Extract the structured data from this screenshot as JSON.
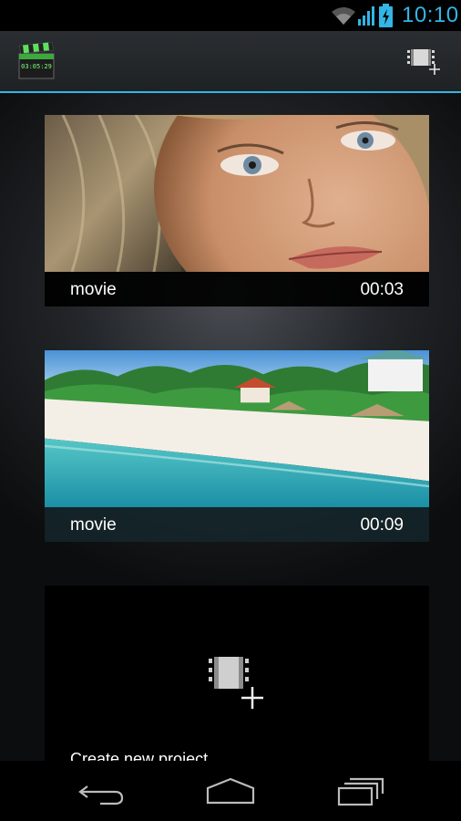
{
  "status_bar": {
    "time": "10:10",
    "icons": [
      "wifi-icon",
      "signal-icon",
      "battery-charging-icon"
    ],
    "accent": "#33b5e5"
  },
  "action_bar": {
    "app_icon": "clapperboard-icon",
    "app_icon_text": "03:05:29",
    "action": "add-video-icon"
  },
  "projects": [
    {
      "name": "movie",
      "duration": "00:03"
    },
    {
      "name": "movie",
      "duration": "00:09"
    }
  ],
  "new_project": {
    "label": "Create new project",
    "icon": "add-video-icon"
  },
  "nav": [
    "back-icon",
    "home-icon",
    "recent-apps-icon"
  ]
}
